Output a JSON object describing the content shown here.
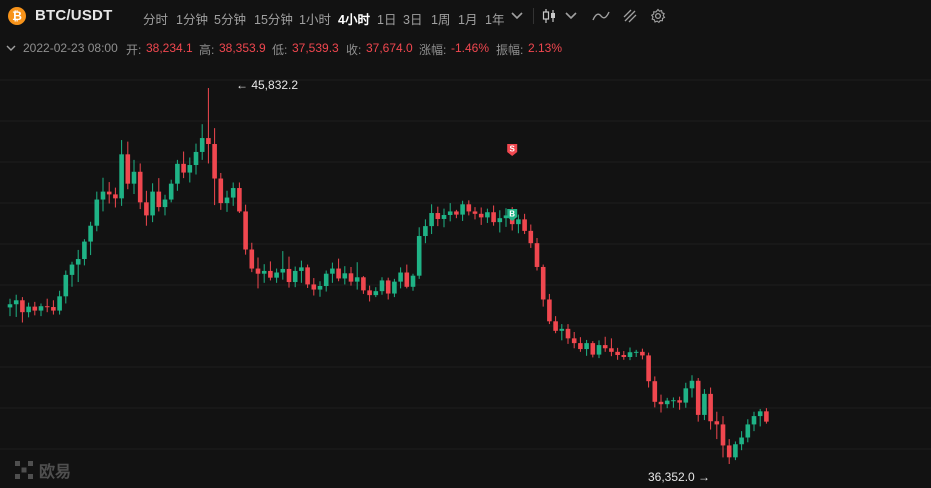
{
  "header": {
    "coin_icon": "bitcoin-icon",
    "coin_glyph": "₿",
    "symbol": "BTC/USDT",
    "timeframes": [
      "分时",
      "1分钟",
      "5分钟",
      "15分钟",
      "1小时",
      "4小时",
      "1日",
      "3日",
      "1周",
      "1月",
      "1年"
    ],
    "active_timeframe": "4小时",
    "icons": [
      "chevron-down-icon",
      "candlestick-icon",
      "chevron-down-icon",
      "indicator-icon",
      "drawing-icon",
      "settings-icon"
    ]
  },
  "info": {
    "datetime": "2022-02-23 08:00",
    "open_label": "开:",
    "open": "38,234.1",
    "high_label": "高:",
    "high": "38,353.9",
    "low_label": "低:",
    "low": "37,539.3",
    "close_label": "收:",
    "close": "37,674.0",
    "change_label": "涨幅:",
    "change": "-1.46%",
    "amplitude_label": "振幅:",
    "amplitude": "2.13%"
  },
  "annotations": {
    "high_marker": "← 45,832.2",
    "low_marker": "36,352.0 →",
    "sell_badge": "S",
    "buy_badge": "B"
  },
  "watermark": "欧易",
  "colors": {
    "up": "#1fb386",
    "down": "#f0474f",
    "background": "#121212",
    "grid": "#1f1f1f"
  },
  "chart_data": {
    "type": "candlestick",
    "title": "",
    "interval": "4小时",
    "y_max": 45832.2,
    "y_min": 36352.0,
    "candles": [
      [
        40300,
        40520,
        40080,
        40380
      ],
      [
        40380,
        40620,
        40060,
        40480
      ],
      [
        40480,
        40560,
        39920,
        40180
      ],
      [
        40180,
        40420,
        40050,
        40320
      ],
      [
        40320,
        40440,
        40100,
        40220
      ],
      [
        40220,
        40400,
        40080,
        40330
      ],
      [
        40330,
        40520,
        40180,
        40310
      ],
      [
        40310,
        40480,
        40120,
        40220
      ],
      [
        40220,
        40720,
        40120,
        40580
      ],
      [
        40580,
        41230,
        40400,
        41120
      ],
      [
        41120,
        41450,
        40820,
        41380
      ],
      [
        41380,
        41750,
        40940,
        41520
      ],
      [
        41520,
        42020,
        41360,
        41960
      ],
      [
        41960,
        42460,
        41620,
        42360
      ],
      [
        42360,
        43220,
        42220,
        43020
      ],
      [
        43020,
        43570,
        42720,
        43220
      ],
      [
        43220,
        43460,
        42920,
        43150
      ],
      [
        43150,
        43320,
        42820,
        43050
      ],
      [
        43050,
        44520,
        42860,
        44160
      ],
      [
        44160,
        44480,
        43280,
        43420
      ],
      [
        43420,
        44020,
        43160,
        43720
      ],
      [
        43720,
        43930,
        42780,
        42950
      ],
      [
        42950,
        43240,
        42360,
        42620
      ],
      [
        42620,
        43430,
        42450,
        43220
      ],
      [
        43220,
        43560,
        42720,
        42830
      ],
      [
        42830,
        43140,
        42620,
        43020
      ],
      [
        43020,
        43520,
        42950,
        43420
      ],
      [
        43420,
        44020,
        43240,
        43920
      ],
      [
        43920,
        44230,
        43560,
        43700
      ],
      [
        43700,
        44080,
        43450,
        43890
      ],
      [
        43890,
        44430,
        43650,
        44220
      ],
      [
        44220,
        44920,
        44020,
        44570
      ],
      [
        44570,
        45832,
        43930,
        44420
      ],
      [
        44420,
        44820,
        42880,
        43550
      ],
      [
        43550,
        43690,
        42760,
        42930
      ],
      [
        42930,
        43240,
        42710,
        43070
      ],
      [
        43070,
        43450,
        42860,
        43310
      ],
      [
        43310,
        43450,
        42680,
        42720
      ],
      [
        42720,
        42890,
        41630,
        41760
      ],
      [
        41760,
        41930,
        41190,
        41280
      ],
      [
        41280,
        41560,
        40780,
        41150
      ],
      [
        41150,
        41390,
        40920,
        41220
      ],
      [
        41220,
        41460,
        40980,
        41050
      ],
      [
        41050,
        41280,
        40920,
        41180
      ],
      [
        41180,
        41720,
        41000,
        41270
      ],
      [
        41270,
        41580,
        40800,
        40940
      ],
      [
        40940,
        41330,
        40810,
        41220
      ],
      [
        41220,
        41480,
        40920,
        41310
      ],
      [
        41310,
        41380,
        40790,
        40880
      ],
      [
        40880,
        41040,
        40600,
        40750
      ],
      [
        40750,
        40960,
        40570,
        40840
      ],
      [
        40840,
        41230,
        40700,
        41150
      ],
      [
        41150,
        41430,
        40920,
        41280
      ],
      [
        41280,
        41530,
        40960,
        41030
      ],
      [
        41030,
        41340,
        40880,
        41160
      ],
      [
        41160,
        41320,
        40850,
        40950
      ],
      [
        40950,
        41440,
        40750,
        41060
      ],
      [
        41060,
        41090,
        40640,
        40730
      ],
      [
        40730,
        40850,
        40450,
        40610
      ],
      [
        40610,
        40810,
        40560,
        40710
      ],
      [
        40710,
        41060,
        40620,
        40980
      ],
      [
        40980,
        41050,
        40500,
        40650
      ],
      [
        40650,
        41020,
        40560,
        40950
      ],
      [
        40950,
        41310,
        40780,
        41180
      ],
      [
        41180,
        41380,
        40780,
        40820
      ],
      [
        40820,
        41150,
        40720,
        41100
      ],
      [
        41100,
        42320,
        41020,
        42100
      ],
      [
        42100,
        42520,
        41920,
        42350
      ],
      [
        42350,
        42900,
        42150,
        42680
      ],
      [
        42680,
        42840,
        42350,
        42530
      ],
      [
        42530,
        42790,
        42320,
        42630
      ],
      [
        42630,
        42930,
        42470,
        42720
      ],
      [
        42720,
        42760,
        42550,
        42640
      ],
      [
        42640,
        42990,
        42480,
        42900
      ],
      [
        42900,
        43000,
        42620,
        42720
      ],
      [
        42720,
        42830,
        42520,
        42660
      ],
      [
        42660,
        42820,
        42380,
        42570
      ],
      [
        42570,
        42790,
        42430,
        42700
      ],
      [
        42700,
        42870,
        42360,
        42450
      ],
      [
        42450,
        42750,
        42190,
        42550
      ],
      [
        42550,
        42800,
        42330,
        42620
      ],
      [
        42620,
        42830,
        42240,
        42400
      ],
      [
        42400,
        42640,
        42170,
        42520
      ],
      [
        42520,
        42660,
        42150,
        42230
      ],
      [
        42230,
        42390,
        41800,
        41920
      ],
      [
        41920,
        42050,
        41230,
        41320
      ],
      [
        41320,
        41380,
        40320,
        40500
      ],
      [
        40500,
        40640,
        39880,
        39950
      ],
      [
        39950,
        40080,
        39650,
        39710
      ],
      [
        39710,
        39880,
        39470,
        39760
      ],
      [
        39760,
        39880,
        39380,
        39520
      ],
      [
        39520,
        39680,
        39270,
        39400
      ],
      [
        39400,
        39550,
        39180,
        39250
      ],
      [
        39250,
        39480,
        39080,
        39400
      ],
      [
        39400,
        39450,
        39040,
        39110
      ],
      [
        39110,
        39470,
        39020,
        39350
      ],
      [
        39350,
        39560,
        39180,
        39270
      ],
      [
        39270,
        39520,
        39070,
        39180
      ],
      [
        39180,
        39280,
        38980,
        39100
      ],
      [
        39100,
        39200,
        38980,
        39050
      ],
      [
        39050,
        39290,
        38970,
        39170
      ],
      [
        39170,
        39230,
        39050,
        39180
      ],
      [
        39180,
        39260,
        38990,
        39090
      ],
      [
        39090,
        39160,
        38280,
        38440
      ],
      [
        38440,
        38560,
        37780,
        37920
      ],
      [
        37920,
        38100,
        37650,
        37860
      ],
      [
        37860,
        38020,
        37760,
        37950
      ],
      [
        37950,
        38030,
        37770,
        37960
      ],
      [
        37960,
        38050,
        37720,
        37900
      ],
      [
        37900,
        38400,
        37770,
        38260
      ],
      [
        38260,
        38590,
        38030,
        38450
      ],
      [
        38450,
        38520,
        37420,
        37590
      ],
      [
        37590,
        38240,
        37460,
        38120
      ],
      [
        38120,
        38280,
        37220,
        37430
      ],
      [
        37430,
        37670,
        36980,
        37350
      ],
      [
        37350,
        37560,
        36520,
        36820
      ],
      [
        36820,
        36980,
        36352,
        36520
      ],
      [
        36520,
        36920,
        36450,
        36850
      ],
      [
        36850,
        37180,
        36700,
        37020
      ],
      [
        37020,
        37480,
        36900,
        37350
      ],
      [
        37350,
        37670,
        37180,
        37560
      ],
      [
        37560,
        37740,
        37300,
        37680
      ],
      [
        37680,
        37760,
        37370,
        37420
      ]
    ]
  }
}
